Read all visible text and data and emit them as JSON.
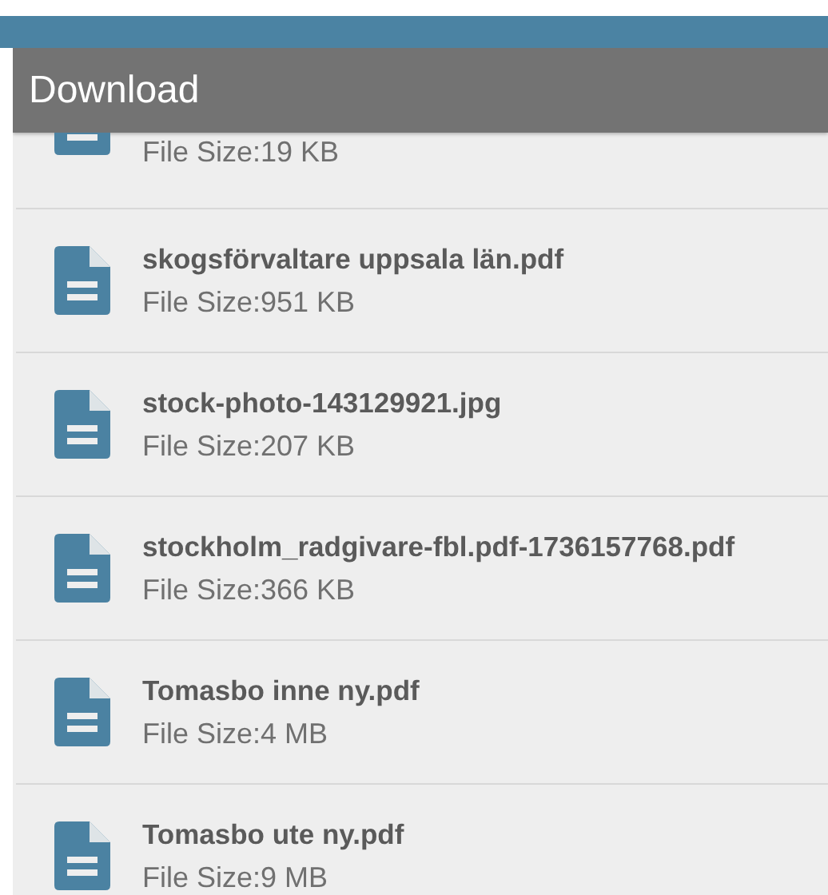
{
  "app_bar": {
    "title": "Download"
  },
  "files": [
    {
      "size": "File Size:19 KB"
    },
    {
      "name": "skogsförvaltare uppsala län.pdf",
      "size": "File Size:951 KB"
    },
    {
      "name": "stock-photo-143129921.jpg",
      "size": "File Size:207 KB"
    },
    {
      "name": "stockholm_radgivare-fbl.pdf-1736157768.pdf",
      "size": "File Size:366 KB"
    },
    {
      "name": "Tomasbo inne ny.pdf",
      "size": "File Size:4 MB"
    },
    {
      "name": "Tomasbo ute ny.pdf",
      "size": "File Size:9 MB"
    }
  ]
}
